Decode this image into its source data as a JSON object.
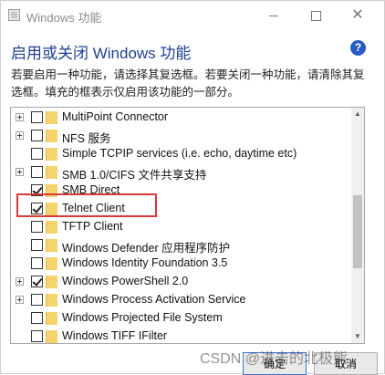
{
  "window": {
    "title": "Windows 功能",
    "heading": "启用或关闭 Windows 功能",
    "description": "若要启用一种功能，请选择其复选框。若要关闭一种功能，请清除其复选框。填充的框表示仅启用该功能的一部分。"
  },
  "features": [
    {
      "label": "MultiPoint Connector",
      "expandable": true,
      "checked": false
    },
    {
      "label": "NFS 服务",
      "expandable": true,
      "checked": false
    },
    {
      "label": "Simple TCPIP services (i.e. echo, daytime etc)",
      "expandable": false,
      "checked": false
    },
    {
      "label": "SMB 1.0/CIFS 文件共享支持",
      "expandable": true,
      "checked": false
    },
    {
      "label": "SMB Direct",
      "expandable": false,
      "checked": true
    },
    {
      "label": "Telnet Client",
      "expandable": false,
      "checked": true
    },
    {
      "label": "TFTP Client",
      "expandable": false,
      "checked": false
    },
    {
      "label": "Windows Defender 应用程序防护",
      "expandable": false,
      "checked": false
    },
    {
      "label": "Windows Identity Foundation 3.5",
      "expandable": false,
      "checked": false
    },
    {
      "label": "Windows PowerShell 2.0",
      "expandable": true,
      "checked": true
    },
    {
      "label": "Windows Process Activation Service",
      "expandable": true,
      "checked": false
    },
    {
      "label": "Windows Projected File System",
      "expandable": false,
      "checked": false
    },
    {
      "label": "Windows TIFF IFilter",
      "expandable": false,
      "checked": false
    }
  ],
  "buttons": {
    "ok": "确定",
    "cancel": "取消"
  },
  "help_icon": "?",
  "watermark": "CSDN @进击的北极熊",
  "colors": {
    "heading": "#1f3f8f",
    "highlight": "#d63a3a",
    "folder": "#f6d36c"
  }
}
